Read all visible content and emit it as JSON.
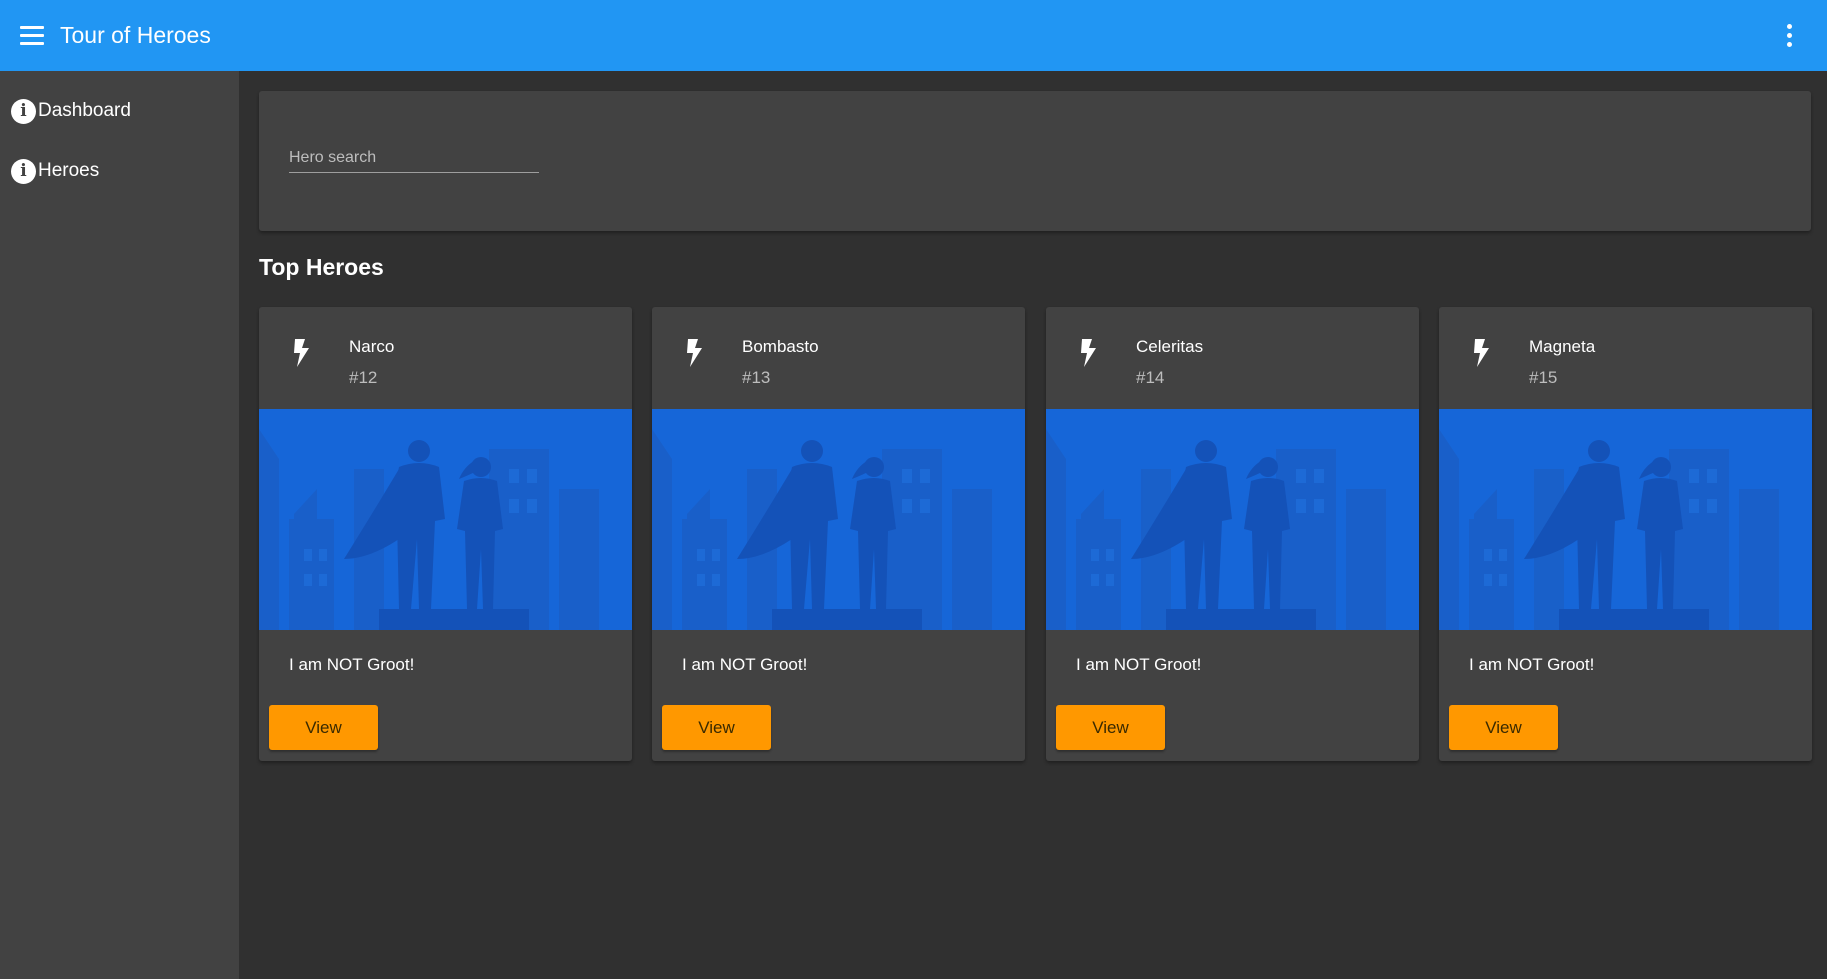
{
  "toolbar": {
    "title": "Tour of Heroes"
  },
  "sidenav": {
    "items": [
      {
        "label": "Dashboard"
      },
      {
        "label": "Heroes"
      }
    ]
  },
  "search": {
    "placeholder": "Hero search",
    "value": ""
  },
  "section": {
    "title": "Top Heroes"
  },
  "heroes": [
    {
      "name": "Narco",
      "id": "#12",
      "text": "I am NOT Groot!",
      "button": "View"
    },
    {
      "name": "Bombasto",
      "id": "#13",
      "text": "I am NOT Groot!",
      "button": "View"
    },
    {
      "name": "Celeritas",
      "id": "#14",
      "text": "I am NOT Groot!",
      "button": "View"
    },
    {
      "name": "Magneta",
      "id": "#15",
      "text": "I am NOT Groot!",
      "button": "View"
    }
  ],
  "colors": {
    "toolbar": "#2196f3",
    "sidenav": "#424242",
    "background": "#303030",
    "card": "#424242",
    "image_bg": "#1666d8",
    "accent_button": "#ff9800"
  },
  "icons": {
    "menu": "menu-icon",
    "more": "more-vert-icon",
    "nav": "info-icon",
    "hero": "lightning-bolt-icon"
  }
}
